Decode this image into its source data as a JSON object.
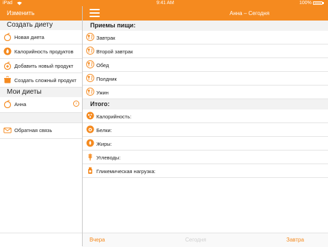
{
  "status_bar": {
    "device": "iPad",
    "time": "9:41 AM",
    "battery": "100%"
  },
  "sidebar": {
    "edit_label": "Изменить",
    "create_section": "Создать диету",
    "create_items": [
      {
        "label": "Новая диета",
        "icon": "apple-icon"
      },
      {
        "label": "Калорийность продуктов",
        "icon": "flame-icon"
      },
      {
        "label": "Добавить новый продукт",
        "icon": "add-product-icon"
      },
      {
        "label": "Создать сложный продукт",
        "icon": "pot-icon"
      }
    ],
    "my_diets_section": "Мои диеты",
    "diets": [
      {
        "label": "Анна",
        "icon": "apple-outline-icon"
      }
    ],
    "feedback": {
      "label": "Обратная связь",
      "icon": "mail-icon"
    }
  },
  "header": {
    "title": "Анна – Сегодня"
  },
  "meals_section": {
    "title": "Приемы пищи:",
    "items": [
      {
        "label": "Завтрак",
        "icon": "cutlery-icon"
      },
      {
        "label": "Второй завтрак",
        "icon": "cutlery-icon"
      },
      {
        "label": "Обед",
        "icon": "cutlery-icon"
      },
      {
        "label": "Полдник",
        "icon": "cutlery-icon"
      },
      {
        "label": "Ужин",
        "icon": "cutlery-icon"
      }
    ]
  },
  "totals_section": {
    "title": "Итого:",
    "items": [
      {
        "label": "Калорийность:",
        "icon": "calories-icon"
      },
      {
        "label": "Белки:",
        "icon": "protein-icon"
      },
      {
        "label": "Жиры:",
        "icon": "fat-drop-icon"
      },
      {
        "label": "Углеводы:",
        "icon": "wheat-icon"
      },
      {
        "label": "Гликемическая нагрузка:",
        "icon": "glycemic-icon"
      }
    ]
  },
  "bottom_bar": {
    "prev": "Вчера",
    "today": "Сегодня",
    "next": "Завтра"
  },
  "colors": {
    "accent": "#f58a1f",
    "section_bg": "#f2f2f2",
    "disabled_text": "#d0d0d0"
  }
}
